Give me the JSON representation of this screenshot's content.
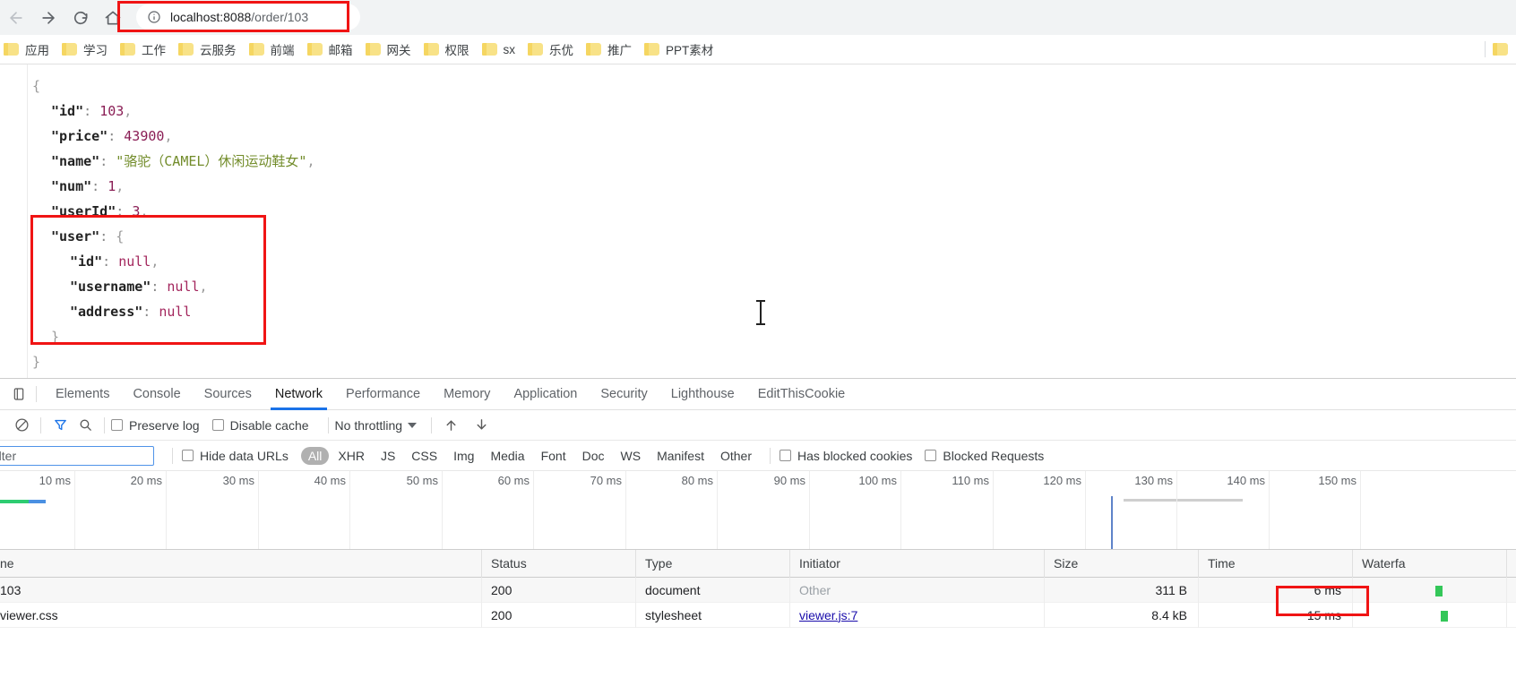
{
  "browser": {
    "nav": {
      "back_icon": "arrow-left-icon",
      "forward_icon": "arrow-right-icon",
      "reload_icon": "reload-icon",
      "home_icon": "home-icon"
    },
    "omnibox": {
      "info_icon": "page-info-icon",
      "host": "localhost:8088",
      "path": "/order/103",
      "full_url": "localhost:8088/order/103"
    }
  },
  "bookmarks": {
    "items": [
      {
        "label": "应用"
      },
      {
        "label": "学习"
      },
      {
        "label": "工作"
      },
      {
        "label": "云服务"
      },
      {
        "label": "前端"
      },
      {
        "label": "邮箱"
      },
      {
        "label": "网关"
      },
      {
        "label": "权限"
      },
      {
        "label": "sx"
      },
      {
        "label": "乐优"
      },
      {
        "label": "推广"
      },
      {
        "label": "PPT素材"
      }
    ],
    "overflow_label": ""
  },
  "json_view": {
    "lines": [
      {
        "indent": 0,
        "tokens": [
          {
            "t": "punc",
            "v": "{"
          }
        ]
      },
      {
        "indent": 1,
        "tokens": [
          {
            "t": "key",
            "v": "\"id\""
          },
          {
            "t": "colon",
            "v": ": "
          },
          {
            "t": "num",
            "v": "103"
          },
          {
            "t": "cn",
            "v": ","
          }
        ]
      },
      {
        "indent": 1,
        "tokens": [
          {
            "t": "key",
            "v": "\"price\""
          },
          {
            "t": "colon",
            "v": ": "
          },
          {
            "t": "num",
            "v": "43900"
          },
          {
            "t": "cn",
            "v": ","
          }
        ]
      },
      {
        "indent": 1,
        "tokens": [
          {
            "t": "key",
            "v": "\"name\""
          },
          {
            "t": "colon",
            "v": ": "
          },
          {
            "t": "str",
            "v": "\"骆驼（CAMEL）休闲运动鞋女\""
          },
          {
            "t": "cn",
            "v": ","
          }
        ]
      },
      {
        "indent": 1,
        "tokens": [
          {
            "t": "key",
            "v": "\"num\""
          },
          {
            "t": "colon",
            "v": ": "
          },
          {
            "t": "num",
            "v": "1"
          },
          {
            "t": "cn",
            "v": ","
          }
        ]
      },
      {
        "indent": 1,
        "tokens": [
          {
            "t": "key",
            "v": "\"userId\""
          },
          {
            "t": "colon",
            "v": ": "
          },
          {
            "t": "num",
            "v": "3"
          },
          {
            "t": "cn",
            "v": ","
          }
        ]
      },
      {
        "indent": 1,
        "tokens": [
          {
            "t": "key",
            "v": "\"user\""
          },
          {
            "t": "colon",
            "v": ": "
          },
          {
            "t": "punc",
            "v": "{"
          }
        ]
      },
      {
        "indent": 2,
        "tokens": [
          {
            "t": "key",
            "v": "\"id\""
          },
          {
            "t": "colon",
            "v": ": "
          },
          {
            "t": "null",
            "v": "null"
          },
          {
            "t": "cn",
            "v": ","
          }
        ]
      },
      {
        "indent": 2,
        "tokens": [
          {
            "t": "key",
            "v": "\"username\""
          },
          {
            "t": "colon",
            "v": ": "
          },
          {
            "t": "null",
            "v": "null"
          },
          {
            "t": "cn",
            "v": ","
          }
        ]
      },
      {
        "indent": 2,
        "tokens": [
          {
            "t": "key",
            "v": "\"address\""
          },
          {
            "t": "colon",
            "v": ": "
          },
          {
            "t": "null",
            "v": "null"
          }
        ]
      },
      {
        "indent": 1,
        "tokens": [
          {
            "t": "punc",
            "v": "}"
          }
        ]
      },
      {
        "indent": 0,
        "tokens": [
          {
            "t": "punc",
            "v": "}"
          }
        ]
      }
    ]
  },
  "annotations": [
    {
      "name": "url-highlight",
      "color": "#f01414"
    },
    {
      "name": "user-object-highlight",
      "color": "#f01414"
    },
    {
      "name": "time-cell-highlight",
      "color": "#f01414"
    }
  ],
  "devtools": {
    "dock_icon": "dock-panel-icon",
    "tabs": [
      {
        "label": "Elements",
        "active": false
      },
      {
        "label": "Console",
        "active": false
      },
      {
        "label": "Sources",
        "active": false
      },
      {
        "label": "Network",
        "active": true
      },
      {
        "label": "Performance",
        "active": false
      },
      {
        "label": "Memory",
        "active": false
      },
      {
        "label": "Application",
        "active": false
      },
      {
        "label": "Security",
        "active": false
      },
      {
        "label": "Lighthouse",
        "active": false
      },
      {
        "label": "EditThisCookie",
        "active": false
      }
    ],
    "toolbar": {
      "clear_icon": "clear-network-log-icon",
      "filter_icon": "filter-icon",
      "search_icon": "search-icon",
      "preserve_log_label": "Preserve log",
      "preserve_log_checked": false,
      "disable_cache_label": "Disable cache",
      "disable_cache_checked": false,
      "throttling_value": "No throttling",
      "import_icon": "import-har-icon",
      "export_icon": "export-har-icon",
      "active_color": "#1a73e8"
    },
    "filterbar": {
      "filter_placeholder": "Filter",
      "filter_value": "",
      "hide_data_urls_label": "Hide data URLs",
      "hide_data_urls_checked": false,
      "types": [
        {
          "label": "All",
          "active": true
        },
        {
          "label": "XHR",
          "active": false
        },
        {
          "label": "JS",
          "active": false
        },
        {
          "label": "CSS",
          "active": false
        },
        {
          "label": "Img",
          "active": false
        },
        {
          "label": "Media",
          "active": false
        },
        {
          "label": "Font",
          "active": false
        },
        {
          "label": "Doc",
          "active": false
        },
        {
          "label": "WS",
          "active": false
        },
        {
          "label": "Manifest",
          "active": false
        },
        {
          "label": "Other",
          "active": false
        }
      ],
      "has_blocked_cookies_label": "Has blocked cookies",
      "has_blocked_cookies_checked": false,
      "blocked_requests_label": "Blocked Requests",
      "blocked_requests_checked": false
    },
    "overview": {
      "ticks": [
        "10 ms",
        "20 ms",
        "30 ms",
        "40 ms",
        "50 ms",
        "60 ms",
        "70 ms",
        "80 ms",
        "90 ms",
        "100 ms",
        "110 ms",
        "120 ms",
        "130 ms",
        "140 ms",
        "150 ms"
      ],
      "green_bar_color": "#2ecc71",
      "blue_bar_color": "#4a90e2",
      "dom_line_color": "#5f83c9"
    },
    "requests_table": {
      "columns": [
        "Name",
        "Status",
        "Type",
        "Initiator",
        "Size",
        "Time",
        "Waterfall"
      ],
      "name_column_label_visible": "ne",
      "waterfall_label_visible": "Waterfa",
      "rows": [
        {
          "name": "103",
          "name_visible": "103",
          "status": "200",
          "type": "document",
          "initiator": "Other",
          "initiator_style": "muted",
          "size": "311 B",
          "time": "6 ms",
          "waterfall_color": "#34c759"
        },
        {
          "name": "viewer.css",
          "name_visible": "viewer.css",
          "status": "200",
          "type": "stylesheet",
          "initiator": "viewer.js:7",
          "initiator_style": "link",
          "size": "8.4 kB",
          "time": "15 ms",
          "waterfall_color": "#34c759"
        }
      ]
    }
  }
}
